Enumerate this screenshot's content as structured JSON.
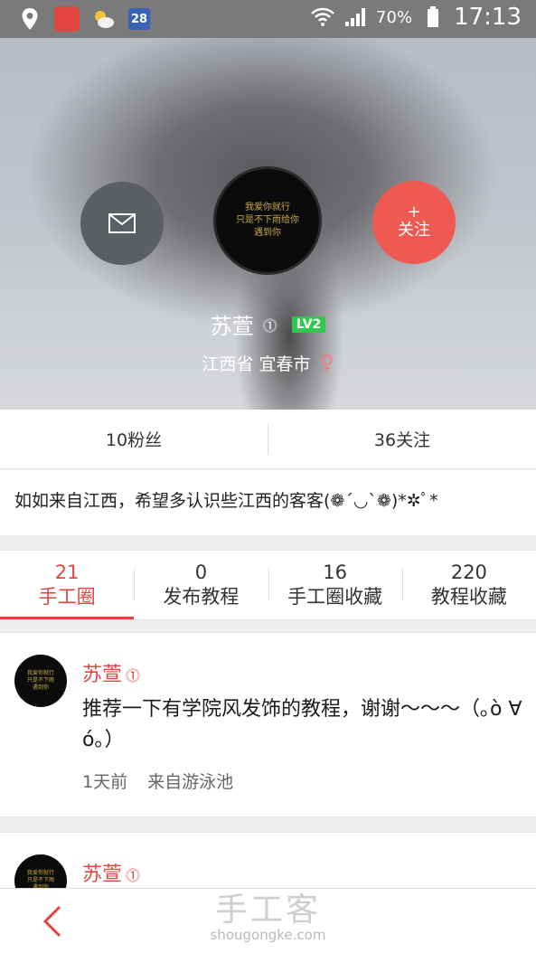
{
  "status_bar": {
    "battery": "70%",
    "time": "17:13",
    "calendar_day": "28"
  },
  "profile": {
    "name": "苏萱",
    "name_badge": "⓵",
    "level": "LV2",
    "location": "江西省 宜春市",
    "gender_symbol": "♀",
    "follow_plus": "+",
    "follow_label": "关注",
    "avatar_text": [
      "我爱你就行",
      "只是不下雨给你",
      "遇到你"
    ]
  },
  "stats": {
    "fans": "10粉丝",
    "following": "36关注"
  },
  "bio": "如如来自江西，希望多认识些江西的客客(❁´◡`❁)*✲ﾟ*",
  "tabs": [
    {
      "count": "21",
      "label": "手工圈"
    },
    {
      "count": "0",
      "label": "发布教程"
    },
    {
      "count": "16",
      "label": "手工圈收藏"
    },
    {
      "count": "220",
      "label": "教程收藏"
    }
  ],
  "posts": [
    {
      "author": "苏萱",
      "badge": "⓵",
      "text": "推荐一下有学院风发饰的教程，谢谢～～～（｡ò ∀ ó｡）",
      "time": "1天前",
      "source": "来自游泳池"
    },
    {
      "author": "苏萱",
      "badge": "⓵"
    }
  ],
  "watermark": {
    "main": "手工客",
    "url": "shougongke.com"
  },
  "colors": {
    "accent": "#e0463f",
    "follow_button": "#ee5a52",
    "level_badge": "#2ec84b"
  }
}
